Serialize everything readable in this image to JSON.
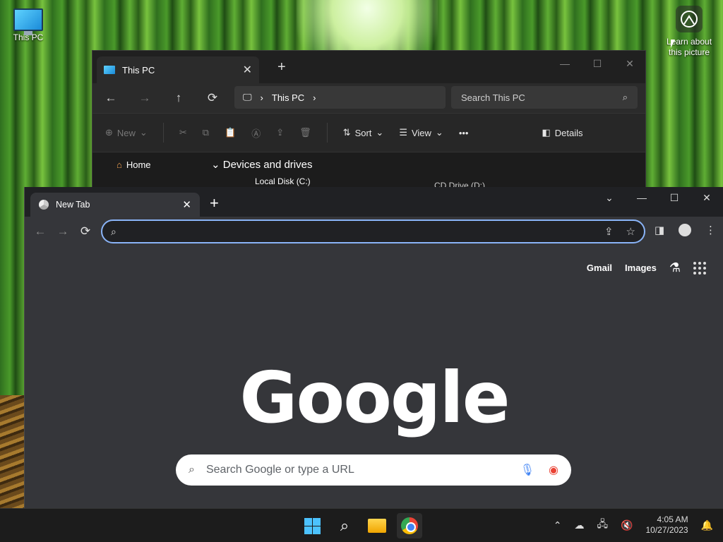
{
  "desktop": {
    "this_pc_label": "This PC",
    "learn_line1": "Learn about",
    "learn_line2": "this picture"
  },
  "explorer": {
    "tab_title": "This PC",
    "tab_close": "✕",
    "new_tab": "+",
    "controls": {
      "minimize": "—",
      "maximize": "☐",
      "close": "✕"
    },
    "nav": {
      "back": "←",
      "forward": "→",
      "up": "↑",
      "refresh": "⟳"
    },
    "address": {
      "crumb_icon": "🖵",
      "sep": "›",
      "crumb": "This PC",
      "sep2": "›"
    },
    "search_placeholder": "Search This PC",
    "commands": {
      "new": "New",
      "sort": "Sort",
      "view": "View",
      "more": "•••",
      "details": "Details"
    },
    "sidebar": {
      "home": "Home"
    },
    "section_title": "Devices and drives",
    "drives": {
      "c": "Local Disk (C:)",
      "d": "CD Drive (D:)"
    }
  },
  "chrome": {
    "tab_title": "New Tab",
    "tab_close": "✕",
    "new_tab": "+",
    "controls": {
      "tabsearch": "⌄",
      "minimize": "—",
      "maximize": "☐",
      "close": "✕"
    },
    "nav": {
      "back": "←",
      "forward": "→",
      "reload": "⟳"
    },
    "omnibox_value": "",
    "links": {
      "gmail": "Gmail",
      "images": "Images"
    },
    "logo": "Google",
    "search_placeholder": "Search Google or type a URL"
  },
  "taskbar": {
    "time": "4:05 AM",
    "date": "10/27/2023"
  },
  "colors": {
    "accent": "#8ab4f8",
    "windows_blue": "#4cc2ff",
    "chrome_bg": "#35363a",
    "explorer_bg": "#1f1f1f"
  }
}
